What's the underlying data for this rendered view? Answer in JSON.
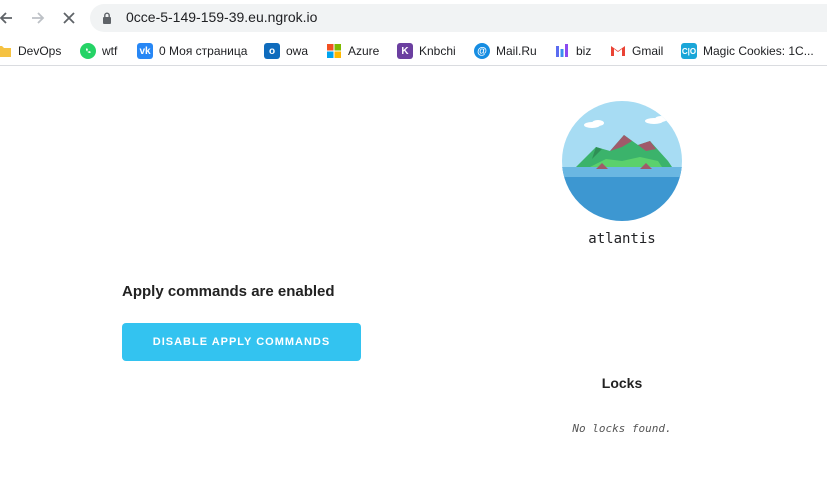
{
  "browser": {
    "url": "0cce-5-149-159-39.eu.ngrok.io",
    "bookmarks": [
      {
        "label": "DevOps",
        "icon": "folder-icon",
        "color": "#f5c242"
      },
      {
        "label": "wtf",
        "icon": "whatsapp-icon",
        "color": "#25d366"
      },
      {
        "label": "0 Моя страница",
        "icon": "vk-icon",
        "color": "#2787f5"
      },
      {
        "label": "owa",
        "icon": "outlook-icon",
        "color": "#0f6cbd"
      },
      {
        "label": "Azure",
        "icon": "windows-icon",
        "color": "#f25022"
      },
      {
        "label": "Knbchi",
        "icon": "kanbanchi-icon",
        "color": "#6b3fa0"
      },
      {
        "label": "Mail.Ru",
        "icon": "mailru-icon",
        "color": "#168de2"
      },
      {
        "label": "biz",
        "icon": "analytics-icon",
        "color": "#5b6cf0"
      },
      {
        "label": "Gmail",
        "icon": "gmail-icon",
        "color": "#ea4335"
      },
      {
        "label": "Magic Cookies: 1C...",
        "icon": "cio-icon",
        "color": "#1aa6d8"
      }
    ]
  },
  "main": {
    "server_name": "atlantis",
    "apply_status": "Apply commands are enabled",
    "disable_button_label": "DISABLE APPLY COMMANDS",
    "locks_title": "Locks",
    "no_locks_text": "No locks found."
  },
  "colors": {
    "button_bg": "#33c3f0",
    "sky": "#a7dcf3",
    "sea": "#3d97d1"
  }
}
